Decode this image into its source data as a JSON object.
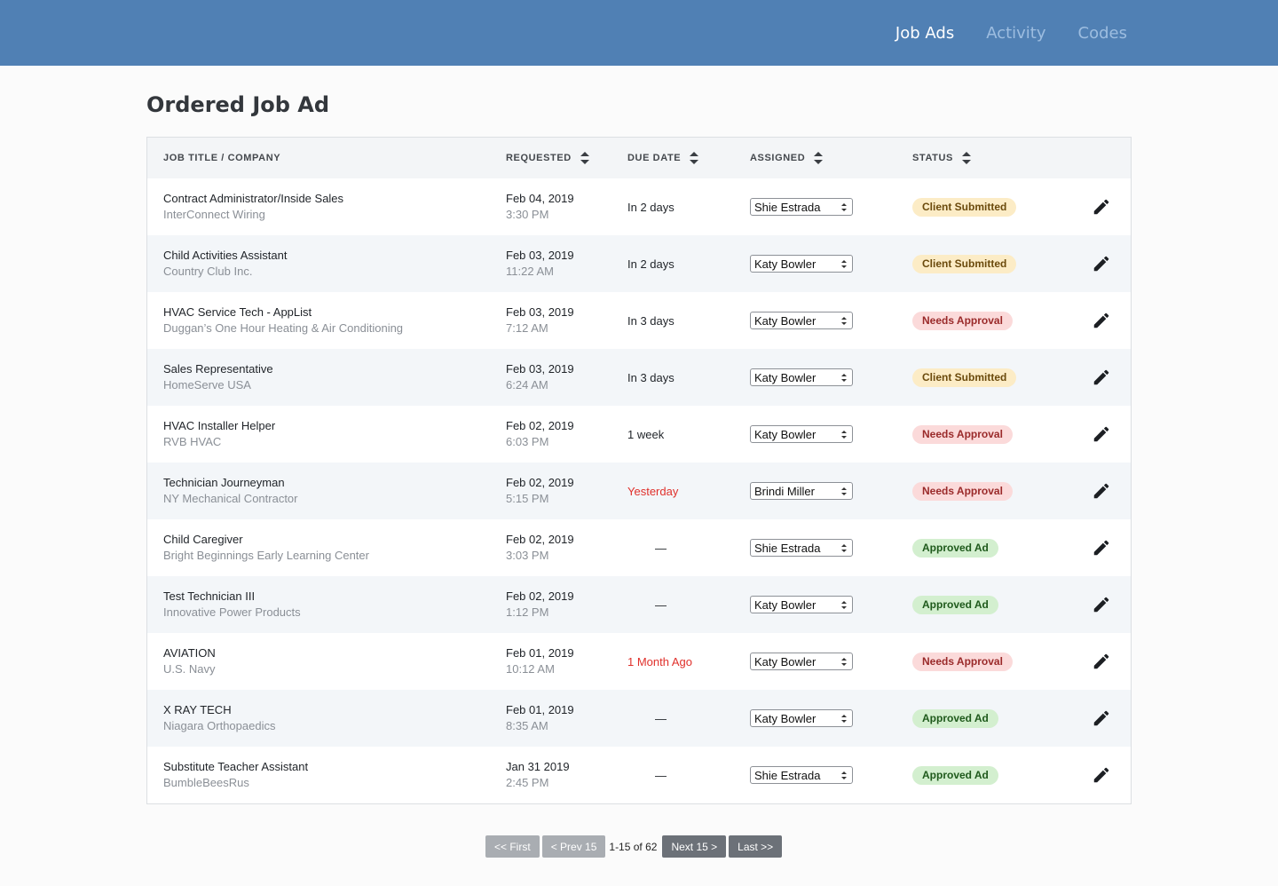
{
  "nav": {
    "items": [
      {
        "label": "Job Ads",
        "active": true
      },
      {
        "label": "Activity",
        "active": false
      },
      {
        "label": "Codes",
        "active": false
      }
    ]
  },
  "page": {
    "title": "Ordered Job Ad"
  },
  "table": {
    "headers": {
      "job": "JOB TITLE / COMPANY",
      "requested": "REQUESTED",
      "due": "DUE DATE",
      "assigned": "ASSIGNED",
      "status": "STATUS"
    },
    "rows": [
      {
        "title": "Contract Administrator/Inside Sales",
        "company": "InterConnect Wiring",
        "req_date": "Feb 04, 2019",
        "req_time": "3:30 PM",
        "due": "In 2 days",
        "due_state": "normal",
        "assigned": "Shie Estrada",
        "status": "Client Submitted",
        "status_kind": "submitted"
      },
      {
        "title": "Child Activities Assistant",
        "company": "Country Club Inc.",
        "req_date": "Feb 03, 2019",
        "req_time": "11:22 AM",
        "due": "In 2 days",
        "due_state": "normal",
        "assigned": "Katy Bowler",
        "status": "Client Submitted",
        "status_kind": "submitted"
      },
      {
        "title": "HVAC Service Tech - AppList",
        "company": "Duggan’s One Hour Heating & Air Conditioning",
        "req_date": "Feb 03, 2019",
        "req_time": "7:12 AM",
        "due": "In 3 days",
        "due_state": "normal",
        "assigned": "Katy Bowler",
        "status": "Needs Approval",
        "status_kind": "needs"
      },
      {
        "title": "Sales Representative",
        "company": "HomeServe USA",
        "req_date": "Feb 03, 2019",
        "req_time": "6:24 AM",
        "due": "In 3 days",
        "due_state": "normal",
        "assigned": "Katy Bowler",
        "status": "Client Submitted",
        "status_kind": "submitted"
      },
      {
        "title": "HVAC Installer Helper",
        "company": "RVB HVAC",
        "req_date": "Feb 02, 2019",
        "req_time": "6:03 PM",
        "due": "1 week",
        "due_state": "normal",
        "assigned": "Katy Bowler",
        "status": "Needs Approval",
        "status_kind": "needs"
      },
      {
        "title": "Technician Journeyman",
        "company": "NY Mechanical Contractor",
        "req_date": "Feb 02, 2019",
        "req_time": "5:15 PM",
        "due": "Yesterday",
        "due_state": "overdue",
        "assigned": "Brindi Miller",
        "status": "Needs Approval",
        "status_kind": "needs"
      },
      {
        "title": "Child Caregiver",
        "company": "Bright Beginnings Early Learning Center",
        "req_date": "Feb 02, 2019",
        "req_time": "3:03 PM",
        "due": "—",
        "due_state": "dash",
        "assigned": "Shie Estrada",
        "status": "Approved Ad",
        "status_kind": "approved"
      },
      {
        "title": "Test Technician III",
        "company": "Innovative Power Products",
        "req_date": "Feb 02, 2019",
        "req_time": "1:12 PM",
        "due": "—",
        "due_state": "dash",
        "assigned": "Katy Bowler",
        "status": "Approved Ad",
        "status_kind": "approved"
      },
      {
        "title": "AVIATION",
        "company": "U.S. Navy",
        "req_date": "Feb 01, 2019",
        "req_time": "10:12 AM",
        "due": "1 Month Ago",
        "due_state": "overdue",
        "assigned": "Katy Bowler",
        "status": "Needs Approval",
        "status_kind": "needs"
      },
      {
        "title": "X RAY TECH",
        "company": "Niagara Orthopaedics",
        "req_date": "Feb 01, 2019",
        "req_time": "8:35 AM",
        "due": "—",
        "due_state": "dash",
        "assigned": "Katy Bowler",
        "status": "Approved Ad",
        "status_kind": "approved"
      },
      {
        "title": "Substitute Teacher Assistant",
        "company": "BumbleBeesRus",
        "req_date": "Jan 31 2019",
        "req_time": "2:45 PM",
        "due": "—",
        "due_state": "dash",
        "assigned": "Shie Estrada",
        "status": "Approved Ad",
        "status_kind": "approved"
      }
    ]
  },
  "status_colors": {
    "submitted": {
      "bg": "#fcecc6",
      "fg": "#6b4a0c"
    },
    "needs": {
      "bg": "#fbdada",
      "fg": "#9a2a2a"
    },
    "approved": {
      "bg": "#d3efcf",
      "fg": "#1f5a1c"
    }
  },
  "pagination": {
    "first": "<< First",
    "prev": "< Prev 15",
    "info": "1-15 of 62",
    "next": "Next 15 >",
    "last": "Last >>"
  }
}
